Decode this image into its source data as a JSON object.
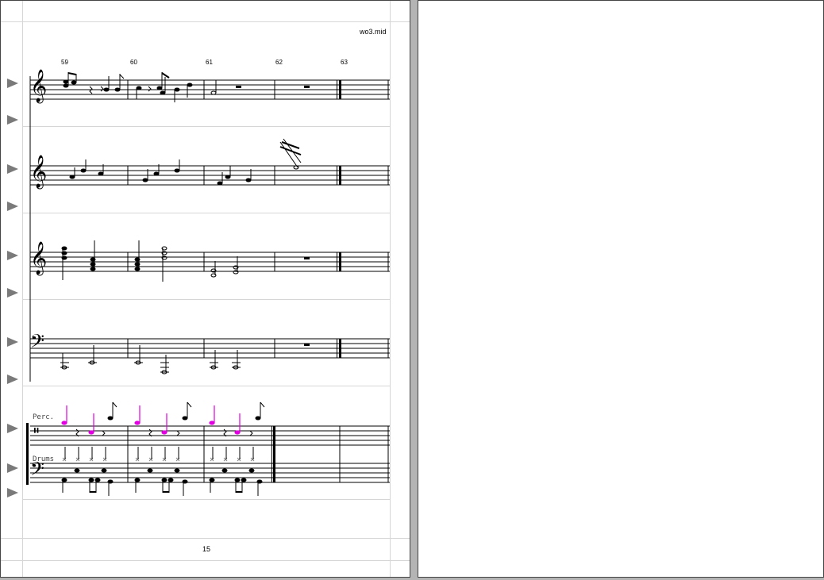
{
  "document": {
    "filename": "wo3.mid",
    "page_number": "15",
    "measure_numbers": [
      "59",
      "60",
      "61",
      "62",
      "63"
    ]
  },
  "staves": [
    {
      "id": "staff-1",
      "clef": "treble",
      "clef_glyph": "𝄞",
      "name": ""
    },
    {
      "id": "staff-2",
      "clef": "treble",
      "clef_glyph": "𝄞",
      "name": ""
    },
    {
      "id": "staff-3",
      "clef": "treble",
      "clef_glyph": "𝄞",
      "name": ""
    },
    {
      "id": "staff-4",
      "clef": "bass",
      "clef_glyph": "𝄢",
      "name": ""
    },
    {
      "id": "staff-perc",
      "clef": "percussion",
      "clef_glyph": "𝄥",
      "name": "Perc."
    },
    {
      "id": "staff-drums",
      "clef": "bass",
      "clef_glyph": "𝄢",
      "name": "Drums"
    }
  ],
  "colors": {
    "workspace": "#b4b4b4",
    "page": "#ffffff",
    "guide": "#d6d6d6",
    "handle": "#7a7a7a",
    "perc_notes": "#e000e0"
  },
  "handle_icon": "staff-handle-triangle-icon"
}
